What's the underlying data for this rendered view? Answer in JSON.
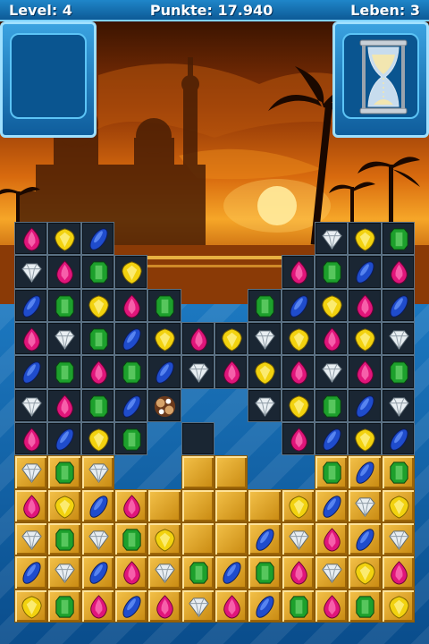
{
  "hud": {
    "level_label": "Level: 4",
    "score_label": "Punkte: 17.940",
    "lives_label": "Leben: 3"
  },
  "timer_icon": "hourglass-icon",
  "colors": {
    "pink": "#e0157a",
    "yellow": "#f2d20f",
    "blue": "#1f4ccc",
    "green": "#1da02c",
    "white": "#e8eef2",
    "tile": "#1a2633",
    "gold": "#d99a1c"
  },
  "board": {
    "rows": [
      [
        "x",
        "x",
        "x",
        "x",
        "x",
        "x",
        "x",
        "x",
        "x",
        "x",
        "x",
        "x"
      ],
      [
        "x",
        "x",
        "x",
        "x",
        "x",
        "x",
        "x",
        "x",
        "x",
        "x",
        "x",
        "x"
      ],
      [
        "x",
        "x",
        "x",
        "x",
        "x",
        "x",
        "x",
        "x",
        "x",
        "x",
        "x",
        "x"
      ],
      [
        "x",
        "x",
        "x",
        "x",
        "x",
        "x",
        "x",
        "x",
        "x",
        "x",
        "x",
        "x"
      ],
      [
        "x",
        "x",
        "x",
        "x",
        "x",
        "x",
        "x",
        "x",
        "x",
        "x",
        "x",
        "x"
      ],
      [
        "x",
        "x",
        "x",
        "x",
        "x",
        "x",
        "x",
        "x",
        "x",
        "x",
        "x",
        "x"
      ],
      [
        "x",
        "x",
        "x",
        "x",
        "x",
        "x",
        "x",
        "x",
        "x",
        "x",
        "x",
        "x"
      ],
      [
        "x",
        "x",
        "x",
        "x",
        "x",
        "x",
        "x",
        "x",
        "x",
        "x",
        "x",
        "x"
      ],
      [
        "x",
        "x",
        "x",
        "x",
        "x",
        "x",
        "x",
        "x",
        "x",
        "x",
        "x",
        "x"
      ],
      [
        "x",
        "x",
        "x",
        "x",
        "x",
        "x",
        "x",
        "x",
        "x",
        "x",
        "x",
        "x"
      ],
      [
        "x",
        "x",
        "x",
        "x",
        "x",
        "x",
        "x",
        "x",
        "x",
        "x",
        "x",
        "x"
      ],
      [
        "x",
        "x",
        "x",
        "x",
        "x",
        "x",
        "x",
        "x",
        "x",
        "x",
        "x",
        "x"
      ]
    ],
    "cells": [
      [
        "t:pink",
        "t:yellow",
        "t:blue",
        "e",
        "e",
        "e",
        "e",
        "e",
        "e",
        "t:white",
        "t:yellow",
        "t:green"
      ],
      [
        "t:white",
        "t:pink",
        "t:green",
        "t:yellow",
        "e",
        "e",
        "e",
        "e",
        "t:pink",
        "t:green",
        "t:blue",
        "t:pink"
      ],
      [
        "t:blue",
        "t:green",
        "t:yellow",
        "t:pink",
        "t:green",
        "e",
        "e",
        "t:green",
        "t:blue",
        "t:yellow",
        "t:pink",
        "t:blue"
      ],
      [
        "t:pink",
        "t:white",
        "t:green",
        "t:blue",
        "t:yellow",
        "t:pink",
        "t:yellow",
        "t:white",
        "t:yellow",
        "t:pink",
        "t:yellow",
        "t:white"
      ],
      [
        "t:blue",
        "t:green",
        "t:pink",
        "t:green",
        "t:blue",
        "t:white",
        "t:pink",
        "t:yellow",
        "t:pink",
        "t:white",
        "t:pink",
        "t:green"
      ],
      [
        "t:white",
        "t:pink",
        "t:green",
        "t:blue",
        "t:special",
        "e",
        "e",
        "t:white",
        "t:yellow",
        "t:green",
        "t:blue",
        "t:white"
      ],
      [
        "t:pink",
        "t:blue",
        "t:yellow",
        "t:green",
        "e",
        "t:empty",
        "e",
        "e",
        "t:pink",
        "t:blue",
        "t:yellow",
        "t:blue"
      ],
      [
        "g:white",
        "g:green",
        "g:white",
        "e",
        "e",
        "g:none",
        "g:none",
        "e",
        "e",
        "g:green",
        "g:blue",
        "g:green"
      ],
      [
        "g:pink",
        "g:yellow",
        "g:blue",
        "g:pink",
        "g:none",
        "g:none",
        "g:none",
        "g:none",
        "g:yellow",
        "g:blue",
        "g:white",
        "g:yellow"
      ],
      [
        "g:white",
        "g:green",
        "g:white",
        "g:green",
        "g:yellow",
        "g:none",
        "g:none",
        "g:blue",
        "g:white",
        "g:pink",
        "g:blue",
        "g:white"
      ],
      [
        "g:blue",
        "g:white",
        "g:blue",
        "g:pink",
        "g:white",
        "g:green",
        "g:blue",
        "g:green",
        "g:pink",
        "g:white",
        "g:yellow",
        "g:pink"
      ],
      [
        "g:yellow",
        "g:green",
        "g:pink",
        "g:blue",
        "g:pink",
        "g:white",
        "g:pink",
        "g:blue",
        "g:green",
        "g:pink",
        "g:green",
        "g:yellow"
      ]
    ]
  }
}
